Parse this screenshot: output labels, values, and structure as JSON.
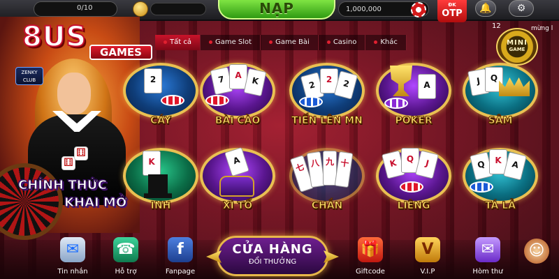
{
  "topbar": {
    "level_text": "0/10",
    "nap_label": "NẠP",
    "balance": "1,000,000",
    "otp_small": "ĐK",
    "otp_label": "OTP"
  },
  "banner": {
    "logo_main": "8US",
    "logo_games": "GAMES",
    "badge_line1": "ZENKY",
    "badge_line2": "CLUB",
    "promo_line1": "CHÍNH THỨC",
    "promo_line2": "KHAI MỞ"
  },
  "tabs": [
    {
      "label": "Tất cả",
      "active": true
    },
    {
      "label": "Game Slot",
      "active": false
    },
    {
      "label": "Game Bài",
      "active": false
    },
    {
      "label": "Casino",
      "active": false
    },
    {
      "label": "Khác",
      "active": false
    }
  ],
  "mini_game": {
    "count": "12",
    "side_text": "mừng l",
    "label": "MINI",
    "sub": "GAME"
  },
  "games": [
    {
      "label": "CÁY"
    },
    {
      "label": "BÀI CÀO"
    },
    {
      "label": "TIẾN LÊN MN"
    },
    {
      "label": "POKER"
    },
    {
      "label": "SÂM"
    },
    {
      "label": "INH"
    },
    {
      "label": "XÌ TỐ"
    },
    {
      "label": "CHẮN"
    },
    {
      "label": "LIÊNG"
    },
    {
      "label": "TÁ LẢ"
    }
  ],
  "bottom": {
    "items": [
      {
        "label": "Tin nhắn",
        "icon": "messenger-icon"
      },
      {
        "label": "Hỗ trợ",
        "icon": "phone-icon"
      },
      {
        "label": "Fanpage",
        "icon": "facebook-icon"
      },
      {
        "label": "Giftcode",
        "icon": "gift-icon"
      },
      {
        "label": "V.I.P",
        "icon": "vip-icon"
      },
      {
        "label": "Hòm thư",
        "icon": "mailbox-icon"
      }
    ],
    "shop_title": "CỬA HÀNG",
    "shop_sub": "ĐỔI THƯỞNG"
  },
  "colors": {
    "accent_red": "#c9132a",
    "gold": "#e9c052",
    "nap_green": "#2f9a12"
  }
}
